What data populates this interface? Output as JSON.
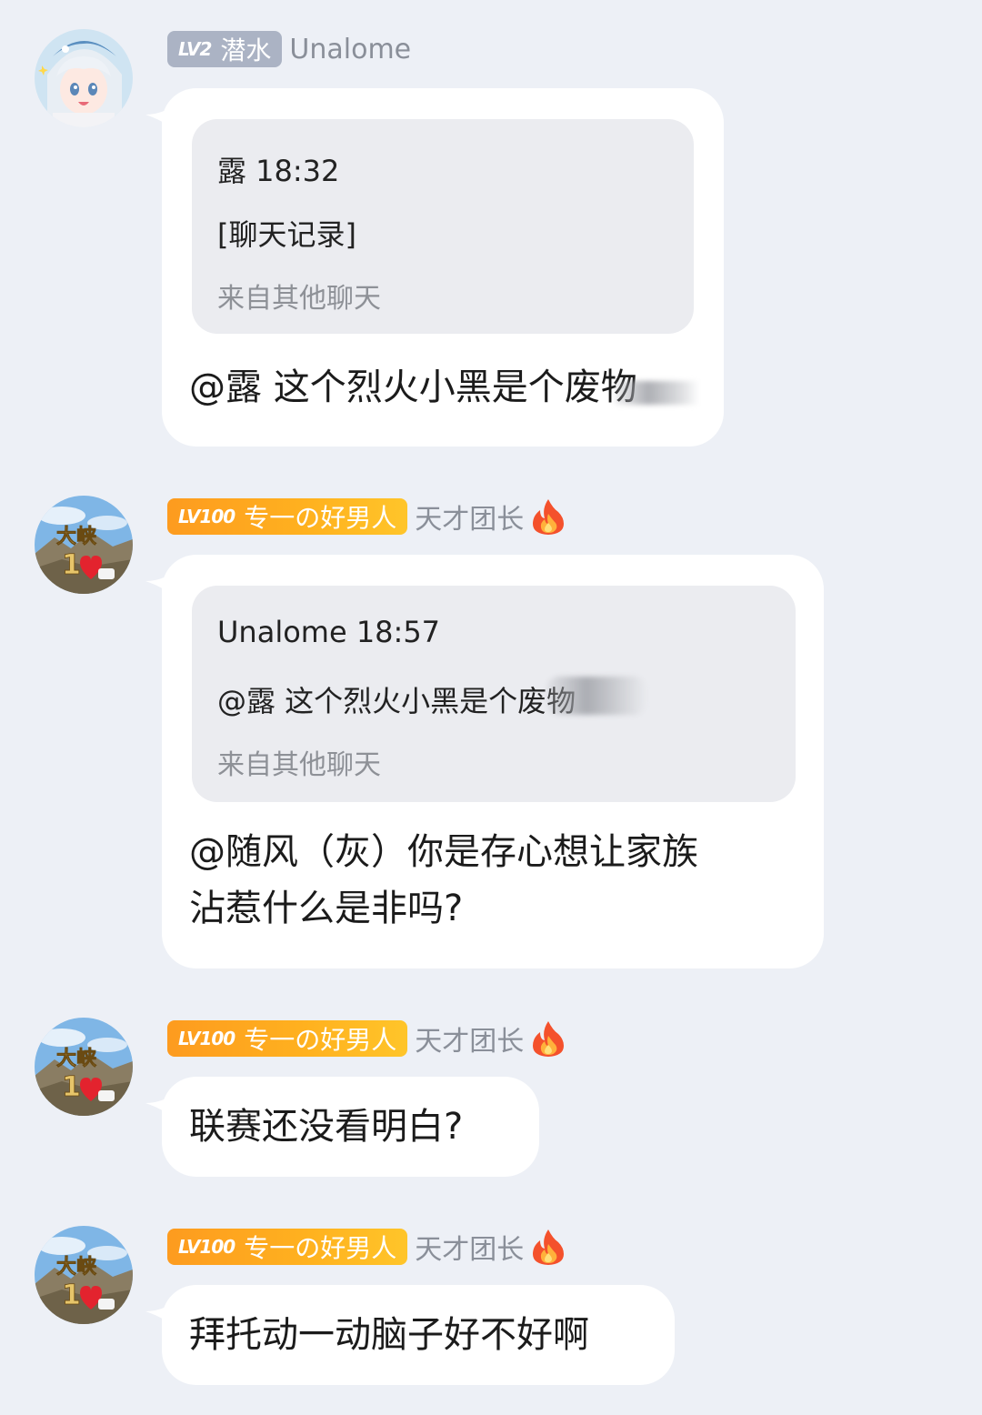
{
  "colors": {
    "background": "#edf0f6",
    "bubble": "#ffffff",
    "quote_bg": "#ebecf0",
    "badge_grey": "#abb3c4",
    "badge_gold": "#ffb21f",
    "secondary_text": "#8a8f99"
  },
  "messages": [
    {
      "avatar": "anime-girl-avatar",
      "badge": {
        "level": "LV2",
        "title": "潜水",
        "style": "grey"
      },
      "name": "Unalome",
      "fire_icon": false,
      "quote": {
        "header": "露 18:32",
        "body": "[聊天记录]",
        "source": "来自其他聊天"
      },
      "text_lines": [
        "@露 这个烈火小黑是个废物"
      ]
    },
    {
      "avatar": "landscape-avatar",
      "badge": {
        "level": "LV100",
        "title": "专一の好男人",
        "style": "gold"
      },
      "name": "天才团长",
      "fire_icon": true,
      "quote": {
        "header": "Unalome 18:57",
        "body": "@露 这个烈火小黑是个废物",
        "source": "来自其他聊天"
      },
      "text_lines": [
        "@随风（灰）你是存心想让家族",
        "沾惹什么是非吗?"
      ]
    },
    {
      "avatar": "landscape-avatar",
      "badge": {
        "level": "LV100",
        "title": "专一の好男人",
        "style": "gold"
      },
      "name": "天才团长",
      "fire_icon": true,
      "text_lines": [
        "联赛还没看明白?"
      ]
    },
    {
      "avatar": "landscape-avatar",
      "badge": {
        "level": "LV100",
        "title": "专一の好男人",
        "style": "gold"
      },
      "name": "天才团长",
      "fire_icon": true,
      "text_lines": [
        "拜托动一动脑子好不好啊"
      ]
    }
  ]
}
